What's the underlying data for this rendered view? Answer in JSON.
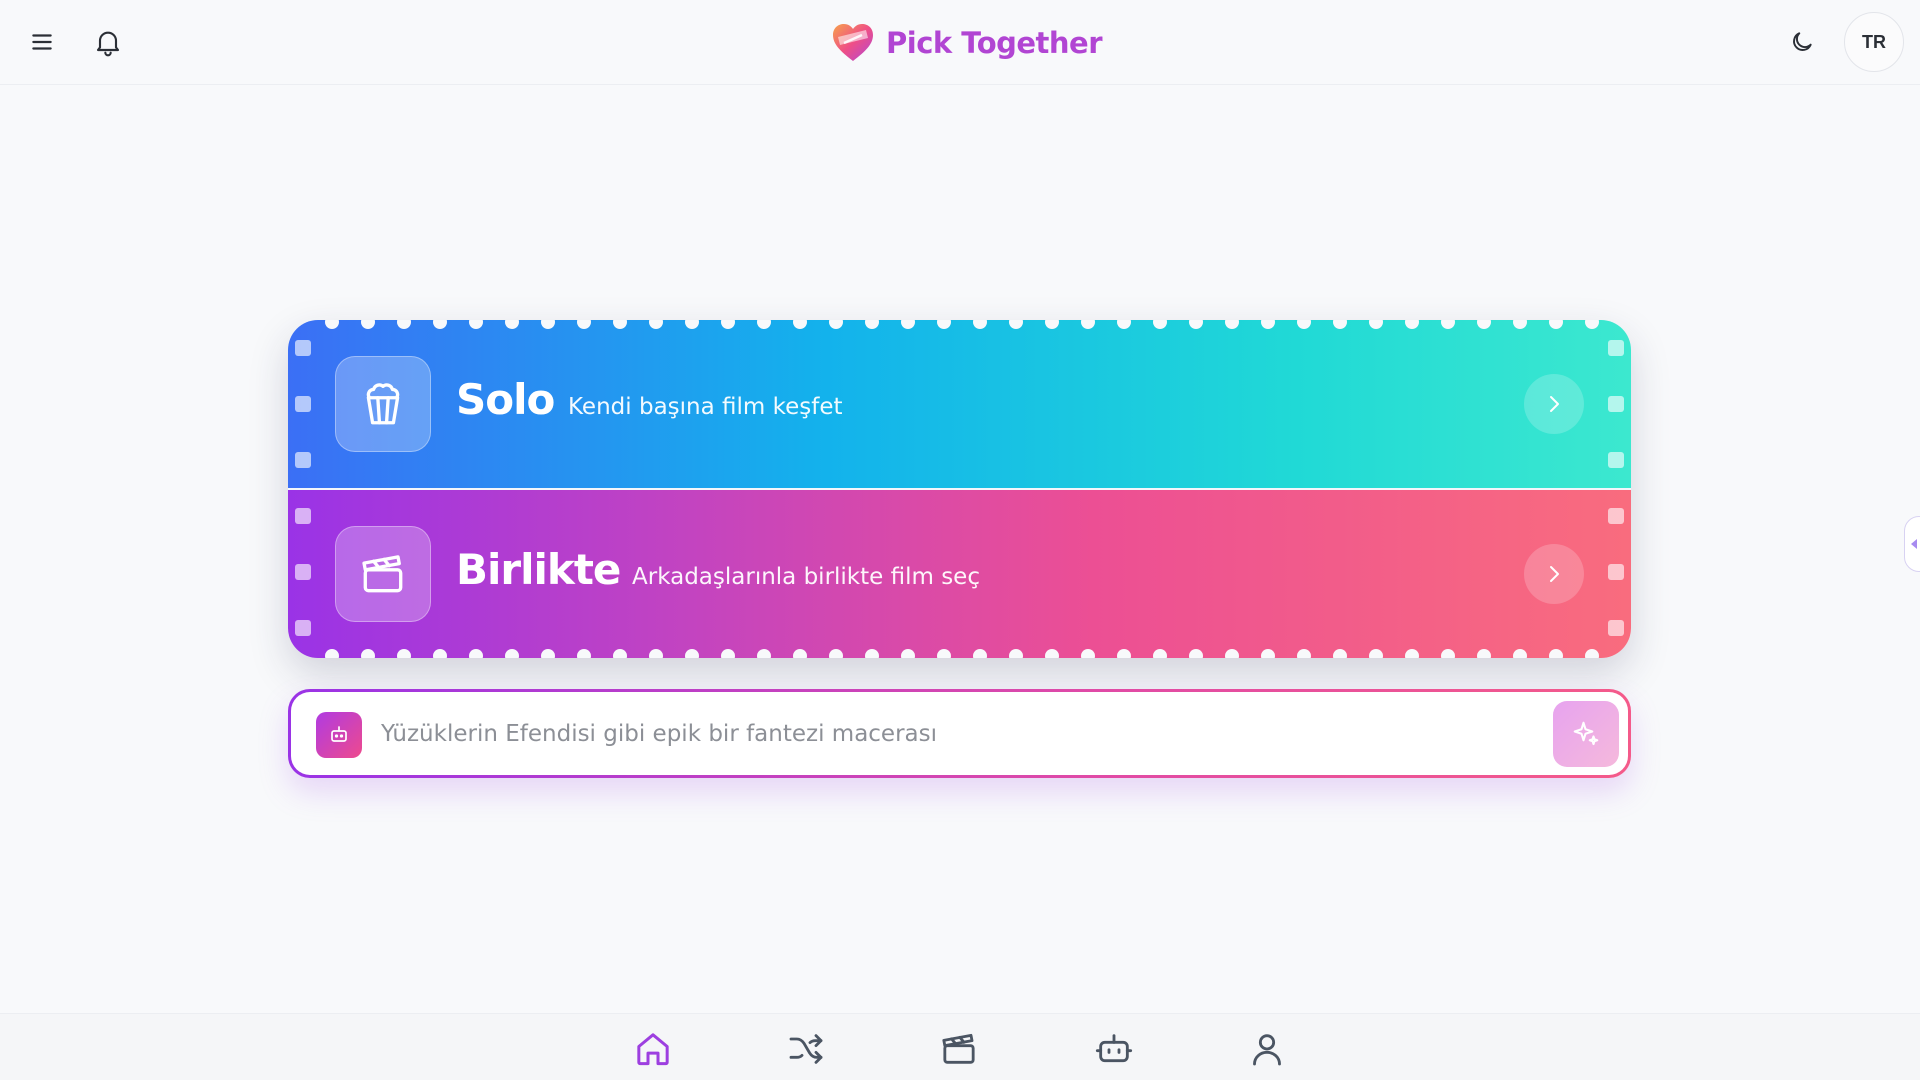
{
  "app": {
    "title": "Pick Together",
    "accent_color": "#b145d3"
  },
  "header": {
    "menu_icon": "menu-icon",
    "notifications_icon": "bell-icon",
    "theme_icon": "moon-icon",
    "language_label": "TR"
  },
  "modes": [
    {
      "title": "Solo",
      "subtitle": "Kendi başına film keşfet",
      "icon": "popcorn-icon"
    },
    {
      "title": "Birlikte",
      "subtitle": "Arkadaşlarınla birlikte film seç",
      "icon": "clapperboard-icon"
    }
  ],
  "ai_search": {
    "placeholder": "Yüzüklerin Efendisi gibi epik bir fantezi macerası",
    "value": "",
    "leading_icon": "robot-icon",
    "submit_icon": "sparkle-icon"
  },
  "bottom_nav": {
    "active": "home",
    "items": [
      {
        "id": "home",
        "icon": "home-icon"
      },
      {
        "id": "shuffle",
        "icon": "shuffle-icon"
      },
      {
        "id": "movies",
        "icon": "clapperboard-icon"
      },
      {
        "id": "assistant",
        "icon": "robot-icon"
      },
      {
        "id": "profile",
        "icon": "user-icon"
      }
    ]
  }
}
